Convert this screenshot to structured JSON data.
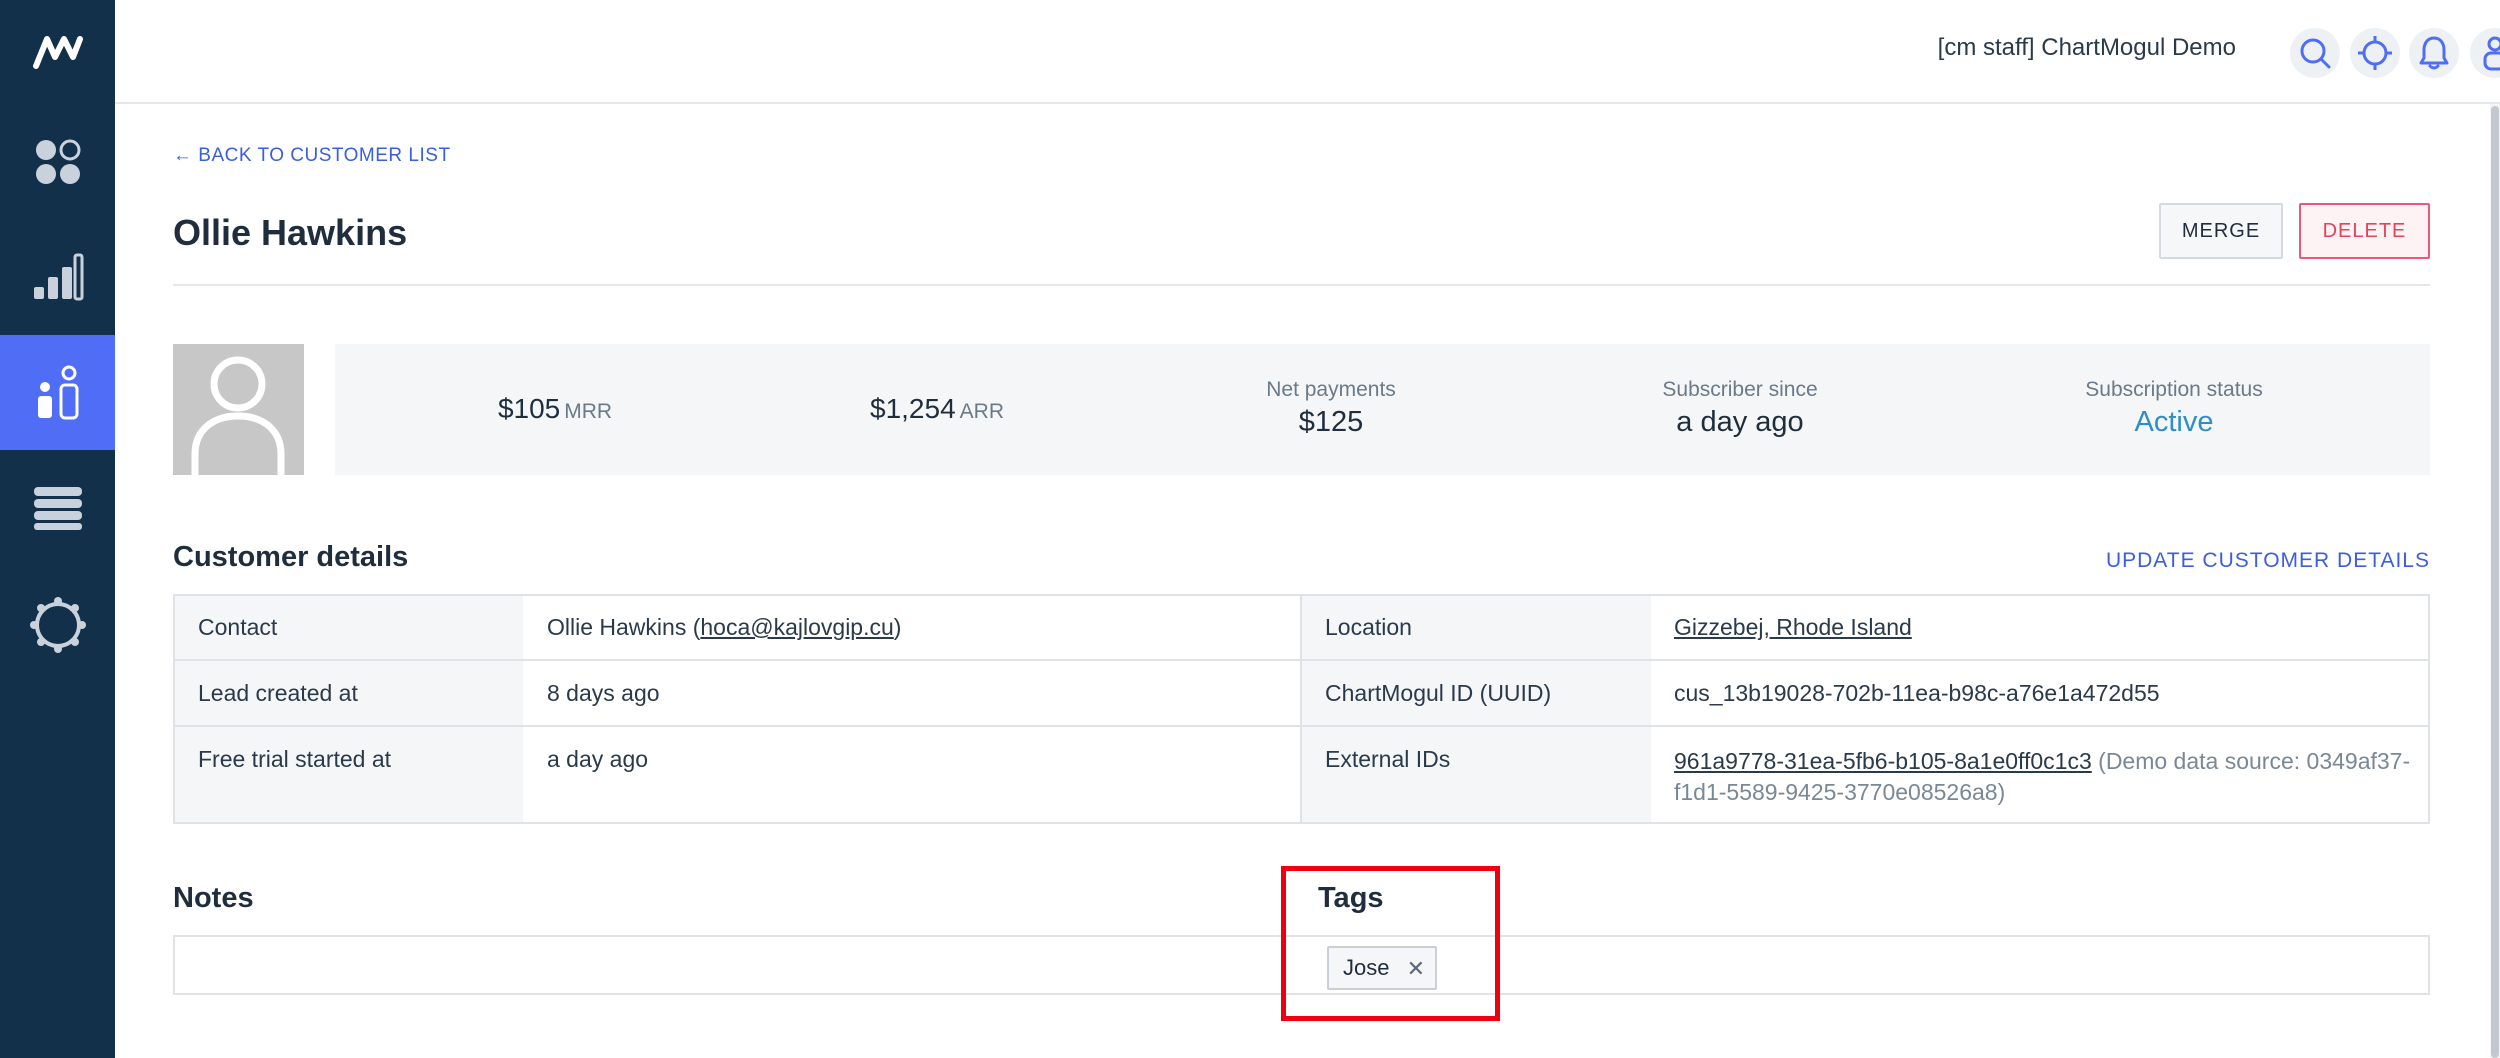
{
  "topbar": {
    "account_name": "[cm staff] ChartMogul Demo",
    "icons": [
      "search-icon",
      "crosshair-icon",
      "bell-icon",
      "user-icon"
    ]
  },
  "sidebar": {
    "logo": "chartmogul-logo",
    "items": [
      {
        "icon": "dashboard-icon",
        "active": false
      },
      {
        "icon": "bar-chart-icon",
        "active": false
      },
      {
        "icon": "customers-icon",
        "active": true
      },
      {
        "icon": "list-icon",
        "active": false
      },
      {
        "icon": "settings-gear-icon",
        "active": false
      }
    ]
  },
  "header": {
    "back_link": "← BACK TO CUSTOMER LIST",
    "title": "Ollie Hawkins",
    "merge_label": "MERGE",
    "delete_label": "DELETE"
  },
  "stats": {
    "mrr_value": "$105",
    "mrr_unit": "MRR",
    "arr_value": "$1,254",
    "arr_unit": "ARR",
    "net_payments_label": "Net payments",
    "net_payments_value": "$125",
    "subscriber_since_label": "Subscriber since",
    "subscriber_since_value": "a day ago",
    "status_label": "Subscription status",
    "status_value": "Active",
    "status_color": "#2d8fc6"
  },
  "details": {
    "title": "Customer details",
    "update_link": "UPDATE CUSTOMER DETAILS",
    "contact_label": "Contact",
    "contact_name": "Ollie Hawkins (",
    "contact_email": "hoca@kajlovgip.cu",
    "contact_close": ")",
    "lead_label": "Lead created at",
    "lead_value": "8 days ago",
    "trial_label": "Free trial started at",
    "trial_value": "a day ago",
    "location_label": "Location",
    "location_value": "Gizzebej, Rhode Island",
    "uuid_label": "ChartMogul ID (UUID)",
    "uuid_value": "cus_13b19028-702b-11ea-b98c-a76e1a472d55",
    "external_label": "External IDs",
    "external_id": "961a9778-31ea-5fb6-b105-8a1e0ff0c1c3",
    "external_source_line1": "(Demo data source: 0349af37-",
    "external_source_line2": "f1d1-5589-9425-3770e08526a8)"
  },
  "notes": {
    "title": "Notes"
  },
  "tags": {
    "title": "Tags",
    "items": [
      "Jose"
    ]
  },
  "colors": {
    "sidebar_bg": "#13304a",
    "accent": "#4f6df5",
    "link": "#3b5ee0",
    "danger": "#e0455b",
    "highlight": "#f0000f"
  }
}
